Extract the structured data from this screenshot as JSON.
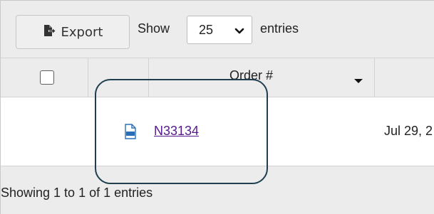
{
  "toolbar": {
    "export_label": "Export",
    "export_icon": "file-export-icon",
    "show_label": "Show",
    "page_length_value": "25",
    "entries_label": "entries"
  },
  "table": {
    "columns": [
      "",
      "",
      "Order #",
      ""
    ],
    "sort_column": "Order #",
    "rows": [
      {
        "icon": "pdf-icon",
        "order": "N33134",
        "date": "Jul 29, 2"
      }
    ]
  },
  "footer": {
    "info": "Showing 1 to 1 of 1 entries"
  },
  "colors": {
    "toolbar_bg": "#ececec",
    "link": "#551a8b",
    "pdf_icon": "#2a6fb5",
    "highlight": "#1f3f4e"
  }
}
